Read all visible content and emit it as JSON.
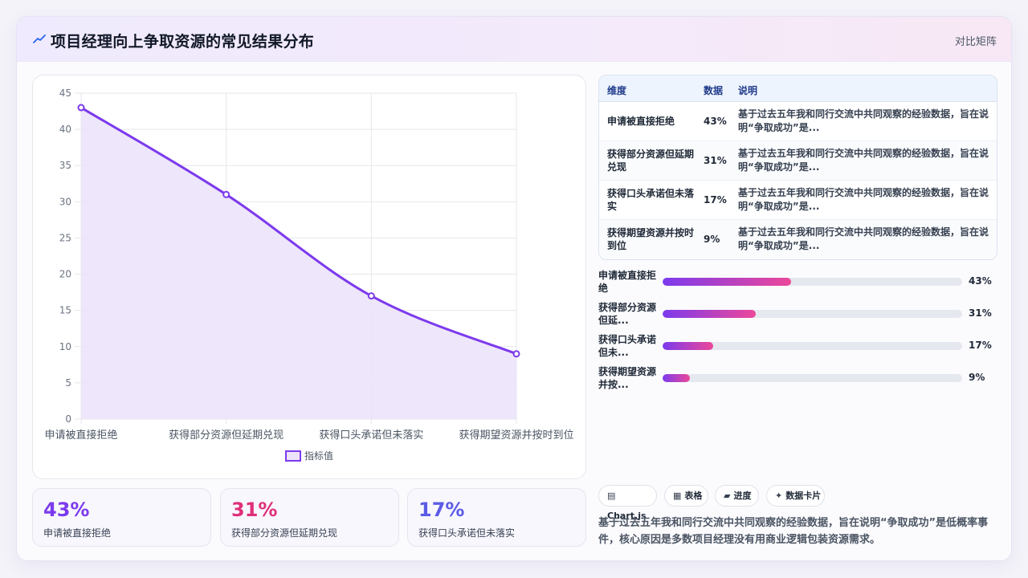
{
  "header": {
    "icon": "trend-line-icon",
    "title": "项目经理向上争取资源的常见结果分布",
    "right_link": "对比矩阵"
  },
  "colors": {
    "accent": "#7c3aed",
    "area_fill": "#ece3fb",
    "pink": "#e0307a",
    "indigo": "#5b5be6",
    "bar_gradient_start": "#7c3aed",
    "bar_gradient_end": "#ec4899"
  },
  "chart_data": {
    "type": "area",
    "categories": [
      "申请被直接拒绝",
      "获得部分资源但延期兑现",
      "获得口头承诺但未落实",
      "获得期望资源并按时到位"
    ],
    "series": [
      {
        "name": "指标值",
        "values": [
          43,
          31,
          17,
          9
        ]
      }
    ],
    "yticks": [
      "0",
      "5",
      "10",
      "15",
      "20",
      "25",
      "30",
      "35",
      "40",
      "45"
    ],
    "ylim": [
      0,
      45
    ],
    "grid": true,
    "legend_position": "bottom",
    "title": "",
    "xlabel": "",
    "ylabel": ""
  },
  "stats": [
    {
      "value": "43%",
      "label": "申请被直接拒绝",
      "color": "#7c3aed"
    },
    {
      "value": "31%",
      "label": "获得部分资源但延期兑现",
      "color": "#e0307a"
    },
    {
      "value": "17%",
      "label": "获得口头承诺但未落实",
      "color": "#5b5be6"
    }
  ],
  "table": {
    "headers": [
      "维度",
      "数据",
      "说明"
    ],
    "rows": [
      {
        "dim": "申请被直接拒绝",
        "val": "43%",
        "desc": "基于过去五年我和同行交流中共同观察的经验数据，旨在说明“争取成功”是..."
      },
      {
        "dim": "获得部分资源但延期兑现",
        "val": "31%",
        "desc": "基于过去五年我和同行交流中共同观察的经验数据，旨在说明“争取成功”是..."
      },
      {
        "dim": "获得口头承诺但未落实",
        "val": "17%",
        "desc": "基于过去五年我和同行交流中共同观察的经验数据，旨在说明“争取成功”是..."
      },
      {
        "dim": "获得期望资源并按时到位",
        "val": "9%",
        "desc": "基于过去五年我和同行交流中共同观察的经验数据，旨在说明“争取成功”是..."
      }
    ]
  },
  "bars": [
    {
      "label": "申请被直接拒绝",
      "value": 43,
      "pct": "43%"
    },
    {
      "label": "获得部分资源但延...",
      "value": 31,
      "pct": "31%"
    },
    {
      "label": "获得口头承诺但未...",
      "value": 17,
      "pct": "17%"
    },
    {
      "label": "获得期望资源并按...",
      "value": 9,
      "pct": "9%"
    }
  ],
  "chips": [
    {
      "icon": "chart-icon",
      "glyph": "▤",
      "label": "Chart.js"
    },
    {
      "icon": "table-icon",
      "glyph": "▦",
      "label": "表格"
    },
    {
      "icon": "progress-icon",
      "glyph": "▰",
      "label": "进度"
    },
    {
      "icon": "sparkle-icon",
      "glyph": "✦",
      "label": "数据卡片"
    }
  ],
  "summary": "基于过去五年我和同行交流中共同观察的经验数据，旨在说明“争取成功”是低概率事件，核心原因是多数项目经理没有用商业逻辑包装资源需求。"
}
